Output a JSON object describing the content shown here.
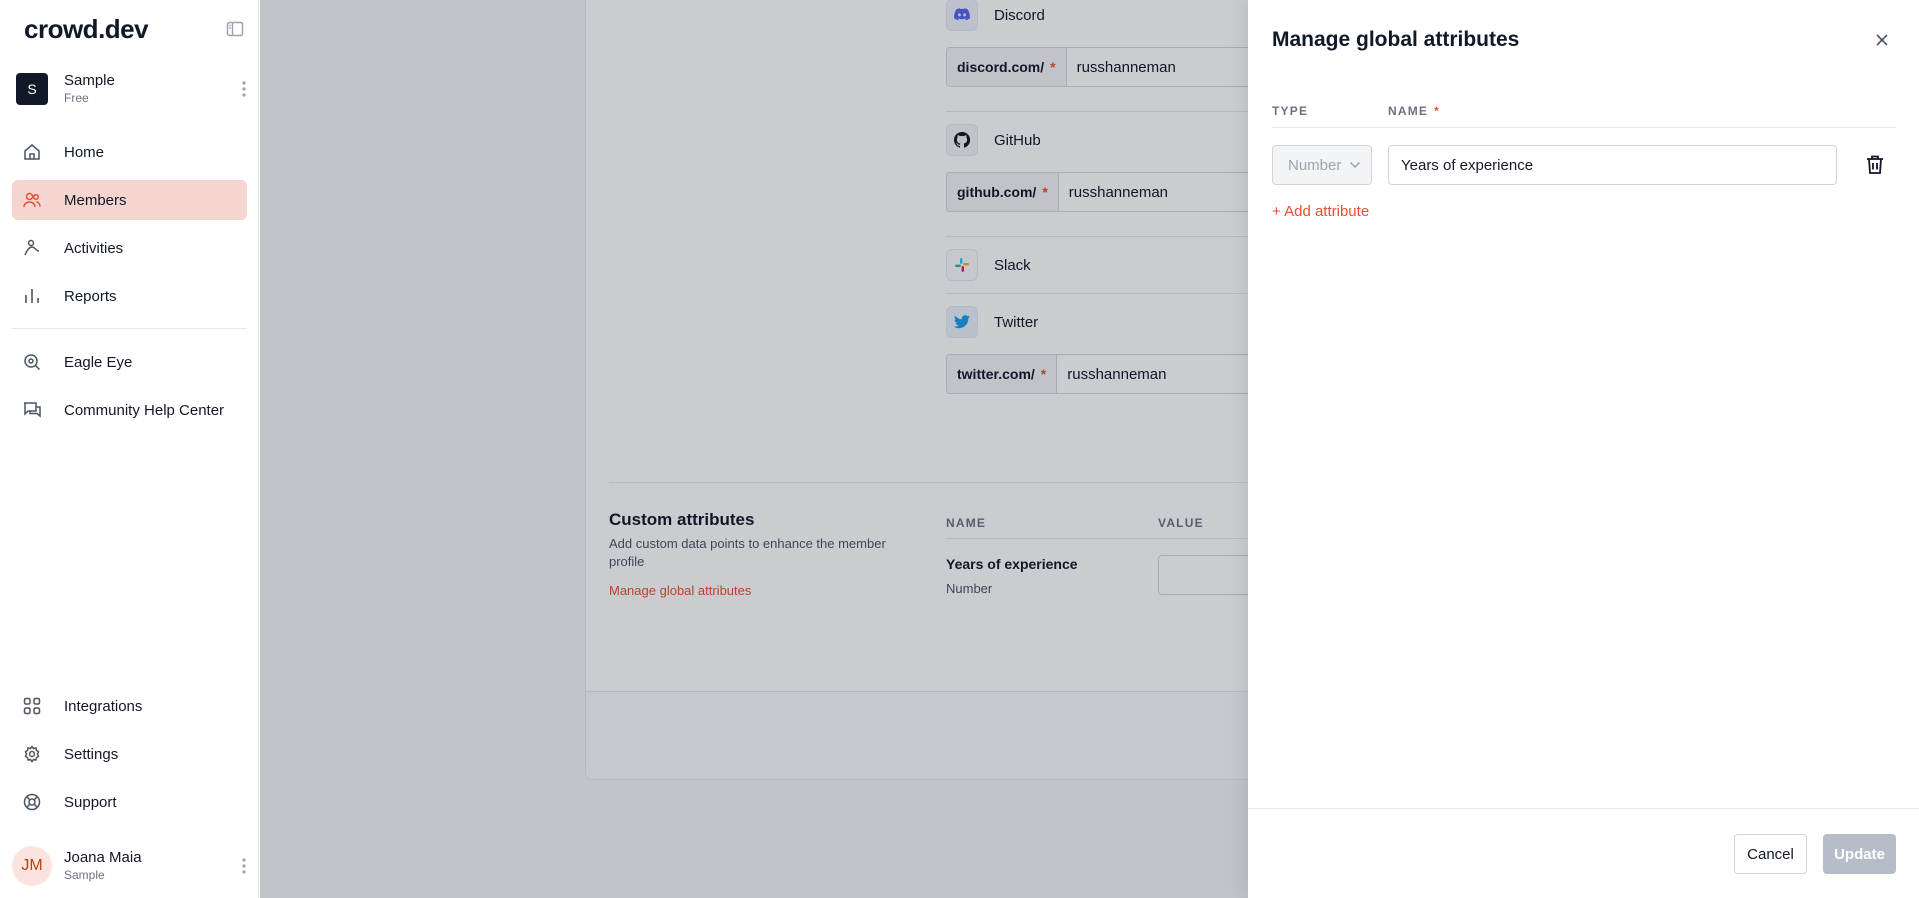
{
  "app": {
    "logo": "crowd.dev"
  },
  "workspace": {
    "initial": "S",
    "name": "Sample",
    "plan": "Free"
  },
  "nav_primary": [
    {
      "label": "Home",
      "icon": "home-icon"
    },
    {
      "label": "Members",
      "icon": "members-icon",
      "active": true
    },
    {
      "label": "Activities",
      "icon": "activities-icon"
    },
    {
      "label": "Reports",
      "icon": "reports-icon"
    }
  ],
  "nav_secondary": [
    {
      "label": "Eagle Eye",
      "icon": "eagle-eye-icon"
    },
    {
      "label": "Community Help Center",
      "icon": "help-center-icon"
    }
  ],
  "nav_bottom": [
    {
      "label": "Integrations",
      "icon": "integrations-icon"
    },
    {
      "label": "Settings",
      "icon": "settings-icon"
    },
    {
      "label": "Support",
      "icon": "support-icon"
    }
  ],
  "user": {
    "initials": "JM",
    "name": "Joana Maia",
    "workspace": "Sample"
  },
  "platforms": {
    "discord": {
      "name": "Discord",
      "prefix": "discord.com/",
      "value": "russhanneman"
    },
    "github": {
      "name": "GitHub",
      "prefix": "github.com/",
      "value": "russhanneman"
    },
    "slack": {
      "name": "Slack"
    },
    "twitter": {
      "name": "Twitter",
      "prefix": "twitter.com/",
      "value": "russhanneman"
    }
  },
  "custom_attributes": {
    "title": "Custom attributes",
    "description": "Add custom data points to enhance the member profile",
    "manage_link": "Manage global attributes",
    "col_name": "NAME",
    "col_value": "VALUE",
    "row": {
      "name": "Years of experience",
      "type": "Number"
    }
  },
  "drawer": {
    "title": "Manage global attributes",
    "col_type": "TYPE",
    "col_name": "NAME",
    "required_mark": "*",
    "type_value": "Number",
    "name_value": "Years of experience",
    "add_label": "+ Add attribute",
    "cancel_label": "Cancel",
    "update_label": "Update"
  },
  "colors": {
    "accent": "#e94f2e",
    "active_nav_bg": "#f5d5d0",
    "discord": "#5865f2",
    "twitter": "#1d9bf0"
  }
}
